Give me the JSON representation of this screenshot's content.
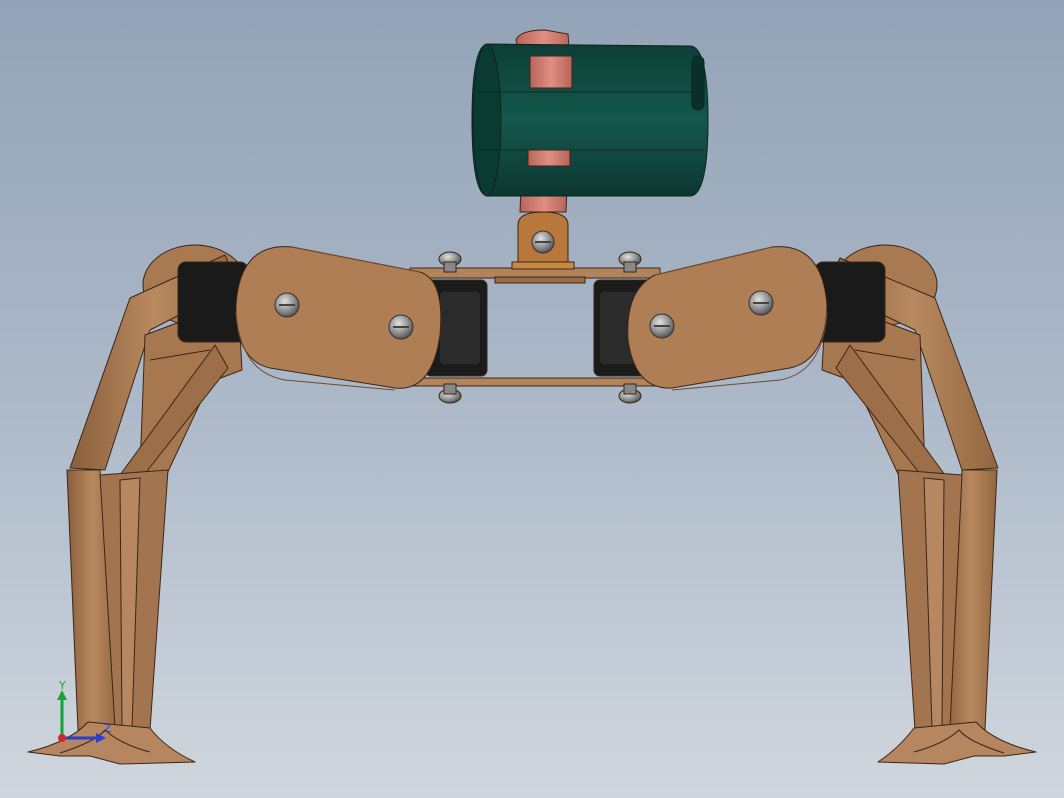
{
  "viewport": {
    "background_top": "#93a3b7",
    "background_bottom": "#d0d6dd"
  },
  "model": {
    "part_color": "#b07e55",
    "part_edge_color": "#3a2618",
    "motor_color": "#0f4f44",
    "bracket_color": "#d47f74",
    "servo_color": "#1b1b1b"
  },
  "triad": {
    "y_label": "Y",
    "z_label": "Z",
    "y_color": "#17a33a",
    "z_color": "#2a3fcf",
    "x_color": "#cf2a2a"
  }
}
